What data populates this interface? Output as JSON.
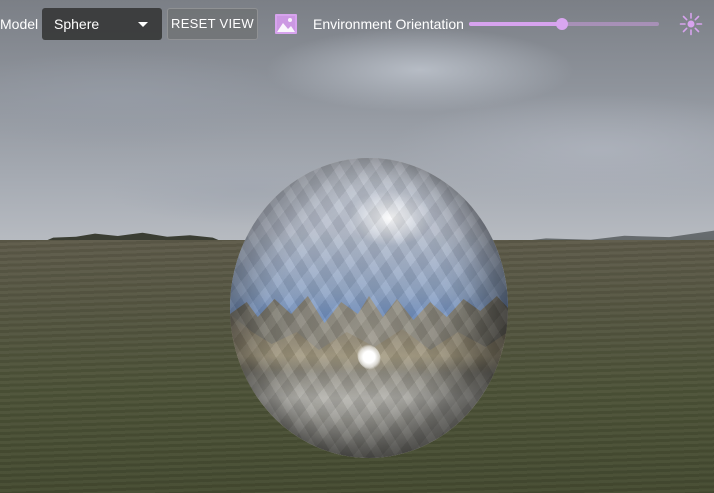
{
  "toolbar": {
    "model_label": "Model",
    "model_select": {
      "selected": "Sphere"
    },
    "reset_view_label": "RESET VIEW",
    "environment_label": "Environment Orientation",
    "environment_slider": {
      "value_fraction": 0.49
    }
  },
  "icons": {
    "environment_image": "image-icon",
    "light": "sun-icon",
    "dropdown": "chevron-down-icon"
  },
  "colors": {
    "accent": "#d7a3ee",
    "control_bg": "#373838"
  }
}
